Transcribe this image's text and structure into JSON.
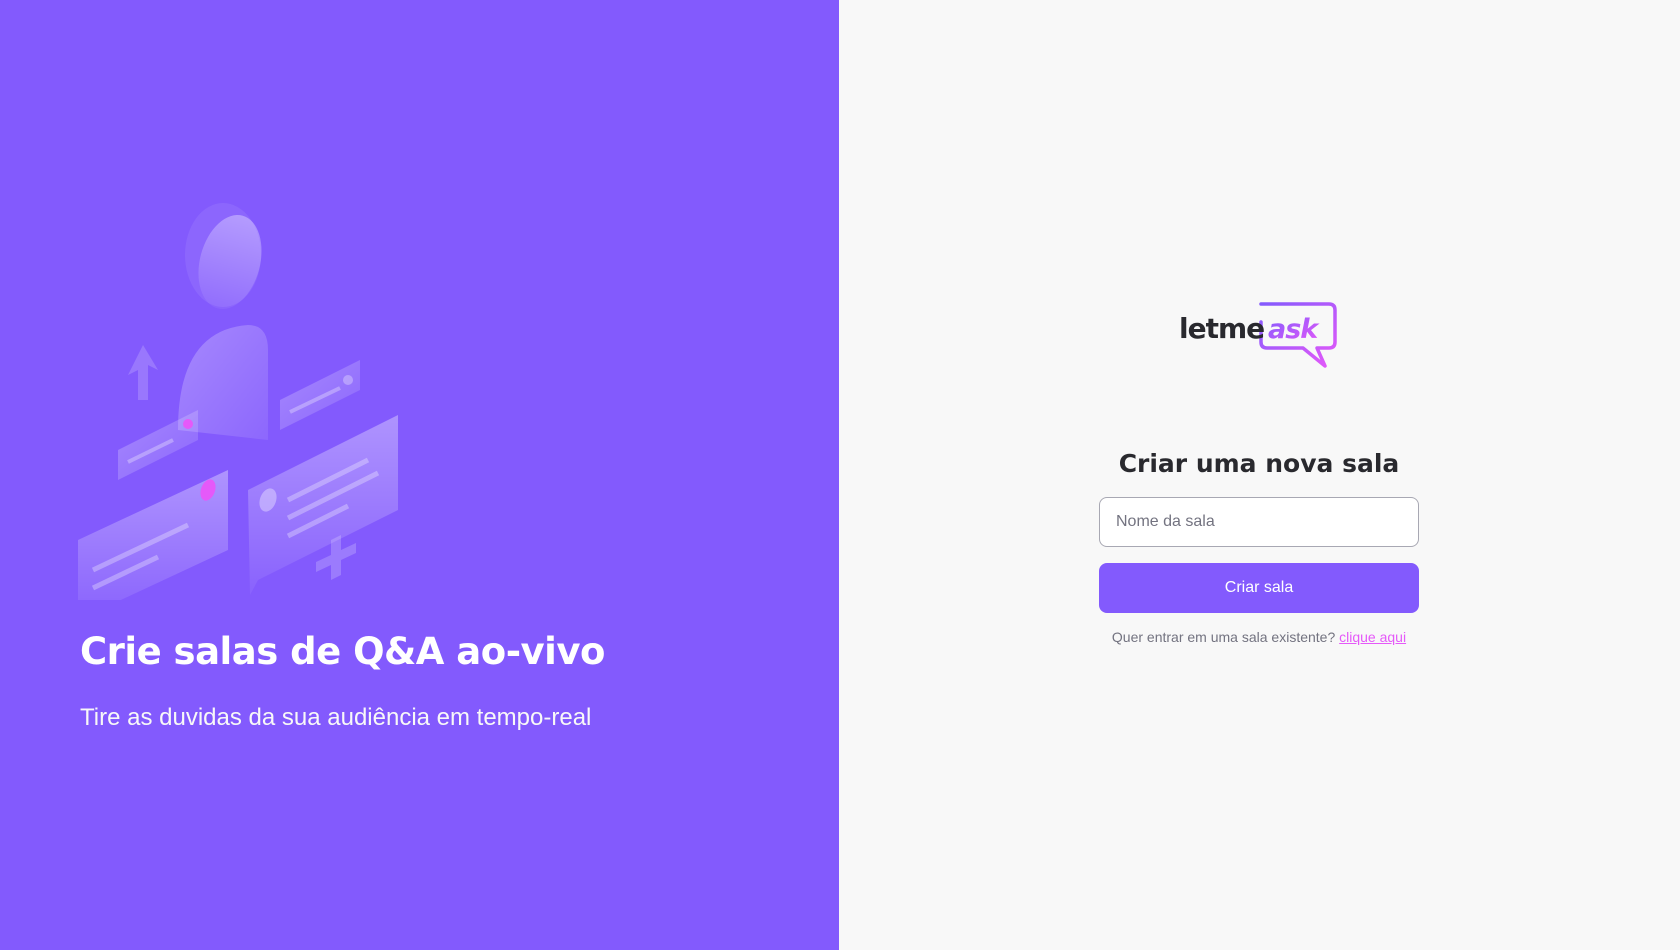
{
  "aside": {
    "illustration": "qa-illustration",
    "title": "Crie salas de Q&A ao-vivo",
    "subtitle": "Tire as duvidas da sua audiência em tempo-real"
  },
  "main": {
    "logo": {
      "part1": "letme",
      "part2": "ask"
    },
    "heading": "Criar uma nova sala",
    "room_input": {
      "value": "",
      "placeholder": "Nome da sala"
    },
    "create_button_label": "Criar sala",
    "existing_room_text": "Quer entrar em uma sala existente?",
    "existing_room_link": "clique aqui"
  },
  "colors": {
    "primary": "#835afd",
    "accent_pink": "#e559f9",
    "background": "#f8f8f8",
    "text_dark": "#29292e",
    "text_muted": "#737380"
  }
}
